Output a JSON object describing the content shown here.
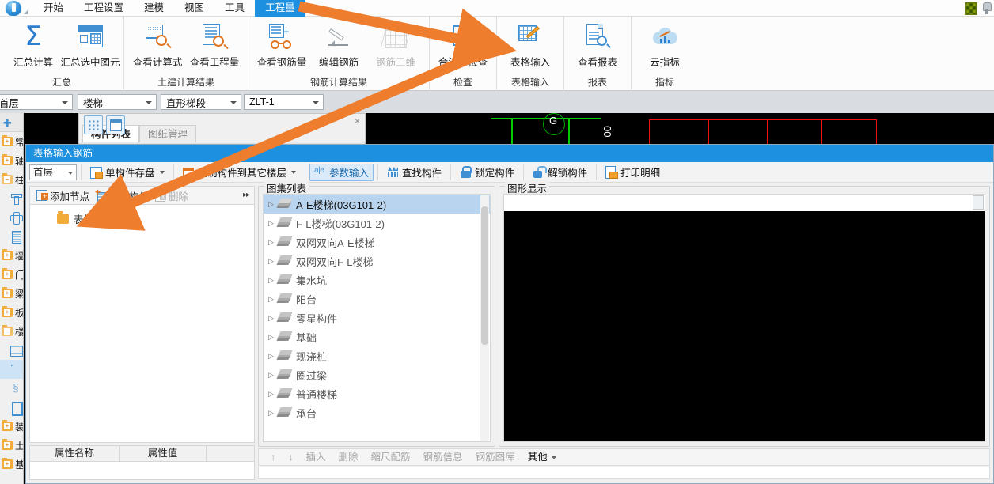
{
  "app": {
    "menu": [
      {
        "label": "开始",
        "active": false
      },
      {
        "label": "工程设置",
        "active": false
      },
      {
        "label": "建模",
        "active": false
      },
      {
        "label": "视图",
        "active": false
      },
      {
        "label": "工具",
        "active": false
      },
      {
        "label": "工程量",
        "active": true
      }
    ],
    "accent_color": "#1e90e0",
    "arrow_color": "#ef7d2e"
  },
  "ribbon": {
    "groups": [
      {
        "label": "汇总",
        "buttons": [
          {
            "label": "汇总计算",
            "icon": "sigma-icon",
            "disabled": false
          },
          {
            "label": "汇总选中图元",
            "icon": "grid-select-icon",
            "disabled": false
          }
        ]
      },
      {
        "label": "土建计算结果",
        "buttons": [
          {
            "label": "查看计算式",
            "icon": "formula-magnifier-icon",
            "disabled": false
          },
          {
            "label": "查看工程量",
            "icon": "document-magnifier-icon",
            "disabled": false
          }
        ]
      },
      {
        "label": "钢筋计算结果",
        "buttons": [
          {
            "label": "查看钢筋量",
            "icon": "glasses-icon",
            "disabled": false
          },
          {
            "label": "编辑钢筋",
            "icon": "pencil-icon",
            "disabled": false
          },
          {
            "label": "钢筋三维",
            "icon": "rebar-3d-icon",
            "disabled": true
          }
        ]
      },
      {
        "label": "检查",
        "buttons": [
          {
            "label": "合法性检查",
            "icon": "checkbox-check-icon",
            "disabled": false
          }
        ]
      },
      {
        "label": "表格输入",
        "buttons": [
          {
            "label": "表格输入",
            "icon": "table-pencil-icon",
            "disabled": false
          }
        ]
      },
      {
        "label": "报表",
        "buttons": [
          {
            "label": "查看报表",
            "icon": "report-magnifier-icon",
            "disabled": false
          }
        ]
      },
      {
        "label": "指标",
        "buttons": [
          {
            "label": "云指标",
            "icon": "cloud-chart-icon",
            "disabled": false
          }
        ]
      }
    ]
  },
  "combobar": {
    "selectors": [
      {
        "name": "floor",
        "value": "首层"
      },
      {
        "name": "component-type",
        "value": "楼梯"
      },
      {
        "name": "component-subtype",
        "value": "直形梯段"
      },
      {
        "name": "component-name",
        "value": "ZLT-1"
      }
    ]
  },
  "leftnav": {
    "items": [
      {
        "label": "常用",
        "icon": "folder-icon",
        "kind": "folder",
        "selected": false
      },
      {
        "label": "轴线",
        "icon": "folder-icon",
        "kind": "folder",
        "selected": false
      },
      {
        "label": "柱",
        "icon": "folder-open-icon",
        "kind": "folder-open",
        "selected": false
      },
      {
        "label": "",
        "icon": "column-icon",
        "kind": "leaf",
        "selected": false
      },
      {
        "label": "",
        "icon": "cross-column-icon",
        "kind": "leaf",
        "selected": false
      },
      {
        "label": "",
        "icon": "column-grid-icon",
        "kind": "leaf",
        "selected": false
      },
      {
        "label": "墙",
        "icon": "folder-icon",
        "kind": "folder",
        "selected": false
      },
      {
        "label": "门窗",
        "icon": "folder-icon",
        "kind": "folder",
        "selected": false
      },
      {
        "label": "梁",
        "icon": "folder-icon",
        "kind": "folder",
        "selected": false
      },
      {
        "label": "板",
        "icon": "folder-icon",
        "kind": "folder",
        "selected": false
      },
      {
        "label": "楼梯",
        "icon": "folder-open-icon",
        "kind": "folder-open",
        "selected": false
      },
      {
        "label": "",
        "icon": "stairs-icon",
        "kind": "leaf",
        "selected": false
      },
      {
        "label": "",
        "icon": "stair-segment-icon",
        "kind": "leaf",
        "selected": true
      },
      {
        "label": "",
        "icon": "squiggle-icon",
        "kind": "leaf",
        "selected": false
      },
      {
        "label": "",
        "icon": "rect-icon",
        "kind": "leaf",
        "selected": false
      },
      {
        "label": "装修",
        "icon": "folder-icon",
        "kind": "folder",
        "selected": false
      },
      {
        "label": "土方",
        "icon": "folder-icon",
        "kind": "folder",
        "selected": false
      },
      {
        "label": "基础",
        "icon": "folder-icon",
        "kind": "folder",
        "selected": false
      }
    ]
  },
  "component_panel": {
    "tabs": [
      {
        "label": "构件列表",
        "active": true
      },
      {
        "label": "图纸管理",
        "active": false
      }
    ],
    "close_label": "×"
  },
  "dialog": {
    "title": "表格输入钢筋",
    "toolbar": {
      "floor_value": "首层",
      "buttons": [
        {
          "label": "单构件存盘",
          "icon": "save-component-icon",
          "dropdown": true,
          "active": false
        },
        {
          "label": "复制构件到其它楼层",
          "icon": "copy-to-floor-icon",
          "dropdown": true,
          "active": false
        },
        {
          "label": "参数输入",
          "icon": "parameter-input-icon",
          "dropdown": false,
          "active": true
        },
        {
          "label": "查找构件",
          "icon": "find-component-icon",
          "dropdown": false,
          "active": false
        },
        {
          "label": "锁定构件",
          "icon": "lock-icon",
          "dropdown": false,
          "active": false
        },
        {
          "label": "解锁构件",
          "icon": "unlock-icon",
          "dropdown": false,
          "active": false
        },
        {
          "label": "打印明细",
          "icon": "print-icon",
          "dropdown": false,
          "active": false
        }
      ]
    },
    "tree_toolbar": {
      "buttons": [
        {
          "label": "添加节点",
          "icon": "add-node-icon",
          "disabled": false
        },
        {
          "label": "添加构件",
          "icon": "add-component-icon",
          "disabled": false
        },
        {
          "label": "删除",
          "icon": "delete-icon",
          "disabled": true
        }
      ],
      "overflow_label": "▸▸"
    },
    "tree": {
      "root_label": "表格构件钢筋"
    },
    "property_grid": {
      "columns": [
        "属性名称",
        "属性值",
        ""
      ],
      "rows": []
    },
    "atlas_panel": {
      "title": "图集列表",
      "items": [
        {
          "label": "A-E楼梯(03G101-2)",
          "selected": true
        },
        {
          "label": "F-L楼梯(03G101-2)",
          "selected": false
        },
        {
          "label": "双网双向A-E楼梯",
          "selected": false
        },
        {
          "label": "双网双向F-L楼梯",
          "selected": false
        },
        {
          "label": "集水坑",
          "selected": false
        },
        {
          "label": "阳台",
          "selected": false
        },
        {
          "label": "零星构件",
          "selected": false
        },
        {
          "label": "基础",
          "selected": false
        },
        {
          "label": "现浇桩",
          "selected": false
        },
        {
          "label": "圈过梁",
          "selected": false
        },
        {
          "label": "普通楼梯",
          "selected": false
        },
        {
          "label": "承台",
          "selected": false
        }
      ]
    },
    "graphic_panel": {
      "title": "图形显示"
    },
    "rebar_toolbar": {
      "buttons": [
        {
          "label": "↑",
          "icon": "arrow-up-icon",
          "disabled": true,
          "dropdown": false
        },
        {
          "label": "↓",
          "icon": "arrow-down-icon",
          "disabled": true,
          "dropdown": false
        },
        {
          "label": "插入",
          "icon": "insert-icon",
          "disabled": true,
          "dropdown": false
        },
        {
          "label": "删除",
          "icon": "delete-row-icon",
          "disabled": true,
          "dropdown": false
        },
        {
          "label": "缩尺配筋",
          "icon": "scale-rebar-icon",
          "disabled": true,
          "dropdown": false
        },
        {
          "label": "钢筋信息",
          "icon": "rebar-info-icon",
          "disabled": true,
          "dropdown": false
        },
        {
          "label": "钢筋图库",
          "icon": "rebar-library-icon",
          "disabled": true,
          "dropdown": false
        },
        {
          "label": "其他",
          "icon": "other-icon",
          "disabled": false,
          "dropdown": true
        }
      ]
    }
  },
  "titlebar_right": {
    "texture_icon": "texture-swatch-icon",
    "pin_icon": "pin-icon"
  },
  "canvas": {
    "axis_label": "G",
    "dimension_text": "00"
  }
}
